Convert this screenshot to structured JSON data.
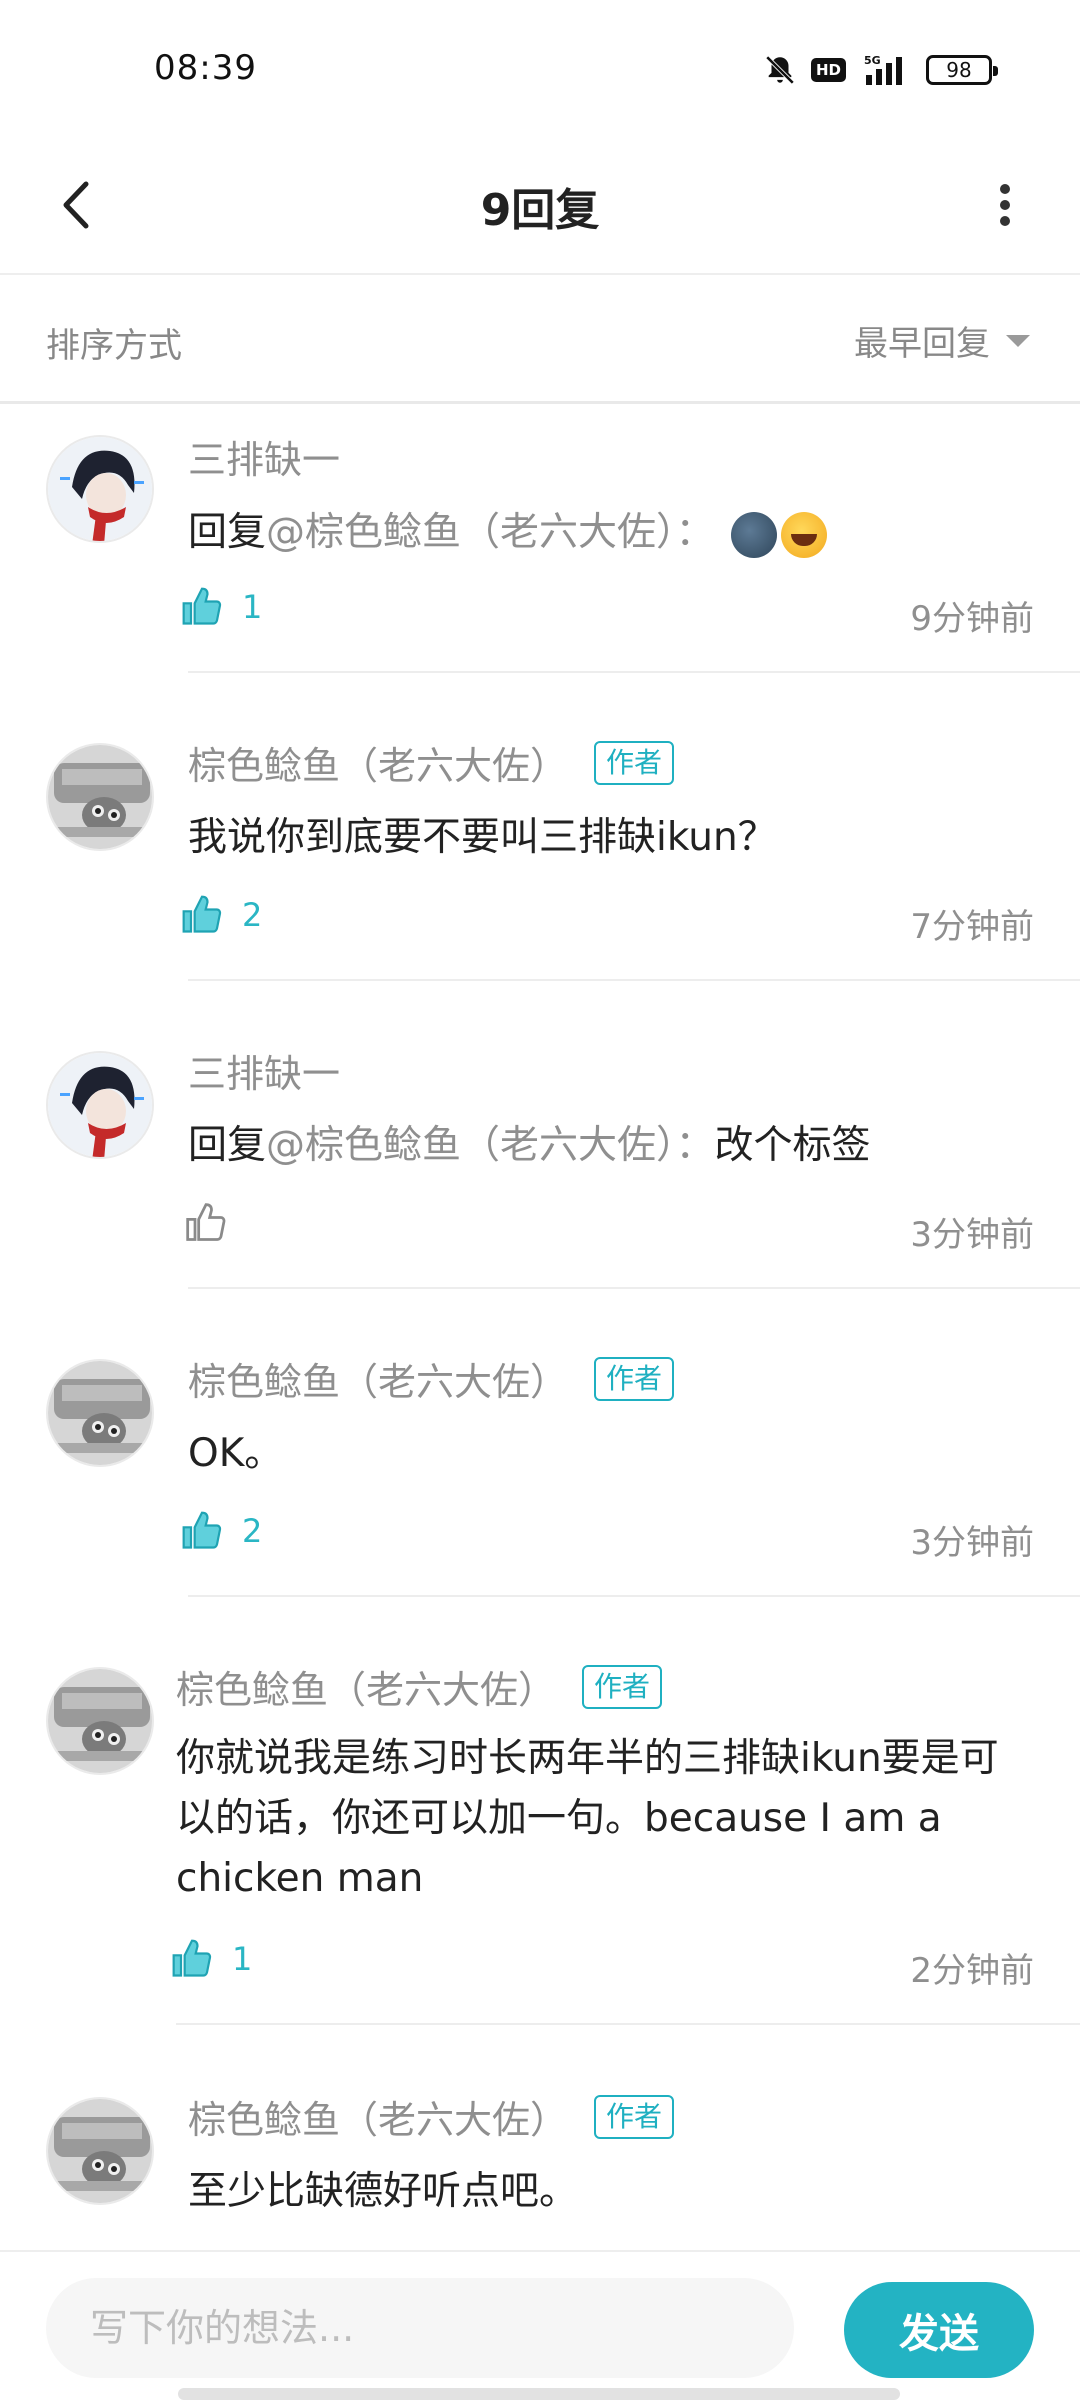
{
  "status_bar": {
    "time": "08:39",
    "battery": "98",
    "network": "5G",
    "hd": "HD"
  },
  "header": {
    "title": "9回复"
  },
  "sort": {
    "label": "排序方式",
    "value": "最早回复"
  },
  "comments": [
    {
      "name": "三排缺一",
      "is_author": false,
      "tag": "",
      "reply_prefix": "回复",
      "mention": "@棕色鲶鱼（老六大佐）：",
      "text": "",
      "emoji": [
        "moon-face",
        "rolling-laughing"
      ],
      "likes": "1",
      "liked": true,
      "time": "9分钟前"
    },
    {
      "name": "棕色鲶鱼（老六大佐）",
      "is_author": true,
      "tag": "作者",
      "reply_prefix": "",
      "mention": "",
      "text": "我说你到底要不要叫三排缺ikun？",
      "likes": "2",
      "liked": true,
      "time": "7分钟前"
    },
    {
      "name": "三排缺一",
      "is_author": false,
      "tag": "",
      "reply_prefix": "回复",
      "mention": "@棕色鲶鱼（老六大佐）：",
      "text": "改个标签",
      "likes": "",
      "liked": false,
      "time": "3分钟前"
    },
    {
      "name": "棕色鲶鱼（老六大佐）",
      "is_author": true,
      "tag": "作者",
      "reply_prefix": "",
      "mention": "",
      "text": "OK。",
      "likes": "2",
      "liked": true,
      "time": "3分钟前"
    },
    {
      "name": "棕色鲶鱼（老六大佐）",
      "is_author": true,
      "tag": "作者",
      "reply_prefix": "",
      "mention": "",
      "text": "你就说我是练习时长两年半的三排缺ikun要是可以的话，你还可以加一句。because I am a chicken man",
      "likes": "1",
      "liked": true,
      "time": "2分钟前"
    },
    {
      "name": "棕色鲶鱼（老六大佐）",
      "is_author": true,
      "tag": "作者",
      "reply_prefix": "",
      "mention": "",
      "text": "至少比缺德好听点吧。",
      "likes": "",
      "liked": false,
      "time": ""
    }
  ],
  "input": {
    "placeholder": "写下你的想法..."
  },
  "send_button": {
    "label": "发送"
  },
  "colors": {
    "accent": "#23b3c3",
    "text_muted": "#8f8f8f"
  }
}
